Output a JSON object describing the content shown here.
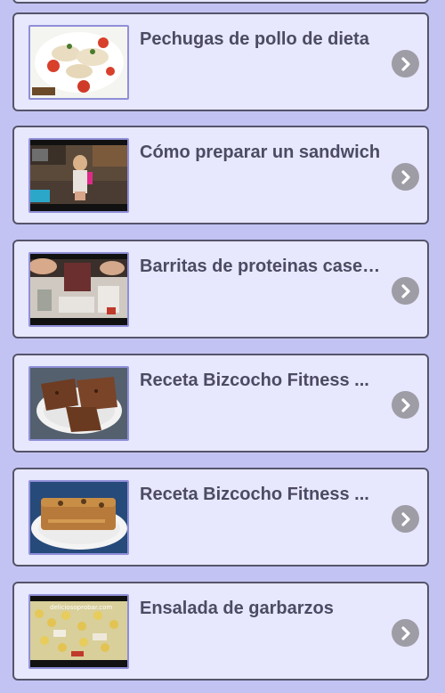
{
  "colors": {
    "background": "#c3c3f3",
    "card_background": "#e7e7fd",
    "card_border": "#55546a",
    "title_text": "#4c4b64",
    "chevron_button": "#9e9da6"
  },
  "items": [
    {
      "title": "Pechugas de pollo de dieta",
      "thumbnail": "grilled-chicken-with-tomatoes",
      "icon": "chevron-right-icon"
    },
    {
      "title": "Cómo preparar un sandwich",
      "thumbnail": "woman-in-kitchen",
      "icon": "chevron-right-icon"
    },
    {
      "title": "Barritas de proteinas caseras",
      "thumbnail": "blender-and-ingredients",
      "icon": "chevron-right-icon"
    },
    {
      "title": "Receta Bizcocho Fitness ...",
      "thumbnail": "sliced-sponge-cake-on-plate",
      "icon": "chevron-right-icon"
    },
    {
      "title": "Receta Bizcocho Fitness ...",
      "thumbnail": "loaf-cake-on-plate",
      "icon": "chevron-right-icon"
    },
    {
      "title": "Ensalada de garbarzos",
      "thumbnail": "chickpea-salad",
      "icon": "chevron-right-icon"
    }
  ],
  "thumbnail_watermarks": {
    "item_6": "deliciosoprobar.com"
  }
}
